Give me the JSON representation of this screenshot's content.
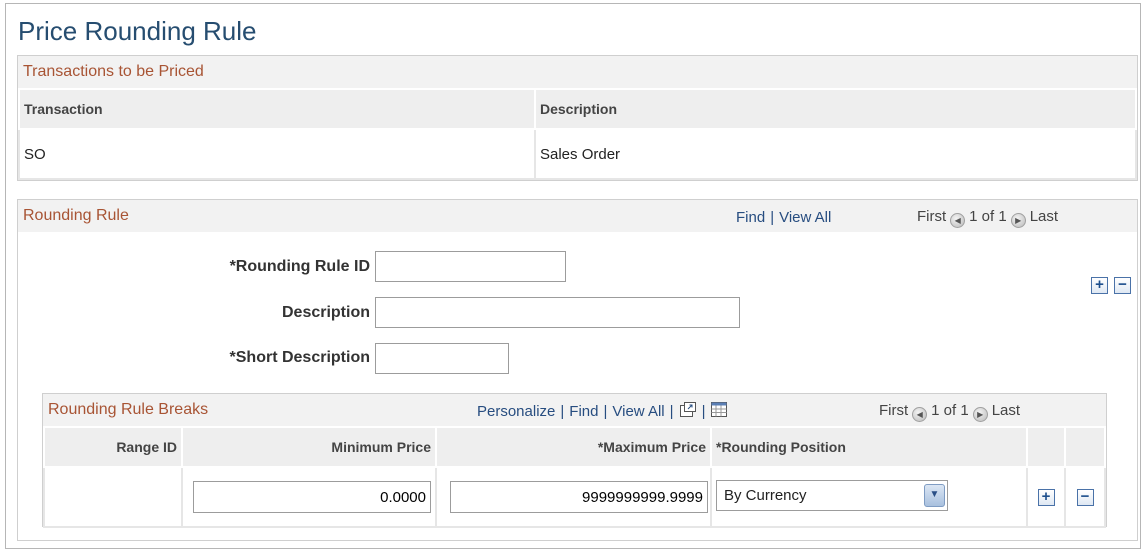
{
  "page": {
    "title": "Price Rounding Rule"
  },
  "transactions": {
    "header": "Transactions to be Priced",
    "columns": [
      "Transaction",
      "Description"
    ],
    "rows": [
      {
        "transaction": "SO",
        "description": "Sales Order"
      }
    ]
  },
  "rounding_rule": {
    "header": "Rounding Rule",
    "nav": {
      "find": "Find",
      "separator": "|",
      "view_all": "View All",
      "first": "First",
      "count": "1 of 1",
      "last": "Last"
    },
    "fields": {
      "rule_id_label": "*Rounding Rule ID",
      "rule_id_value": "",
      "description_label": "Description",
      "description_value": "",
      "short_description_label": "*Short Description",
      "short_description_value": ""
    },
    "add_label": "+",
    "remove_label": "−"
  },
  "breaks": {
    "header": "Rounding Rule Breaks",
    "nav": {
      "personalize": "Personalize",
      "find": "Find",
      "view_all": "View All",
      "separator": "|",
      "first": "First",
      "count": "1 of 1",
      "last": "Last"
    },
    "columns": {
      "range_id": "Range ID",
      "minimum_price": "Minimum Price",
      "maximum_price": "*Maximum Price",
      "rounding_position": "*Rounding Position"
    },
    "row": {
      "range_id": "",
      "minimum_price": "0.0000",
      "maximum_price": "9999999999.9999",
      "rounding_position": "By Currency"
    },
    "add_label": "+",
    "remove_label": "−"
  },
  "icons": {
    "prev": "previous-arrow-icon",
    "next": "next-arrow-icon",
    "new_window": "new-window-icon",
    "download": "spreadsheet-download-icon",
    "dropdown": "chevron-down-icon"
  }
}
